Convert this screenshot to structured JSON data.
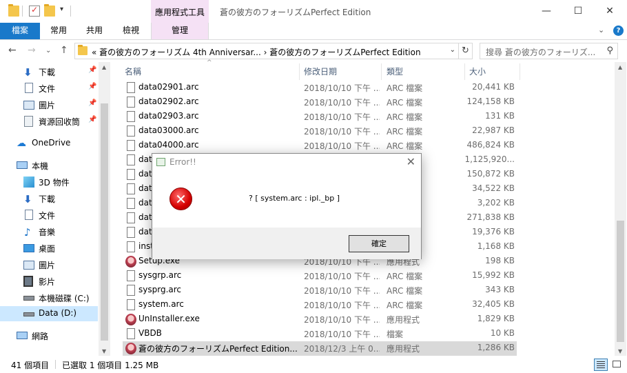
{
  "titlebar": {
    "context_tab_title": "應用程式工具",
    "window_title": "蒼の彼方のフォーリズムPerfect Edition",
    "minimize": "—",
    "maximize": "☐",
    "close": "✕"
  },
  "ribbon": {
    "tabs": [
      "檔案",
      "常用",
      "共用",
      "檢視",
      "管理"
    ]
  },
  "address": {
    "path": "« 蒼の彼方のフォーリズム 4th Anniversar...  ›  蒼の彼方のフォーリズムPerfect Edition",
    "search_placeholder": "搜尋 蒼の彼方のフォーリズ..."
  },
  "navpane": {
    "quick_access": [
      {
        "label": "下載",
        "icon": "download-icon"
      },
      {
        "label": "文件",
        "icon": "document-icon"
      },
      {
        "label": "圖片",
        "icon": "picture-icon"
      },
      {
        "label": "資源回收筒",
        "icon": "recycle-bin-icon"
      }
    ],
    "onedrive": "OneDrive",
    "this_pc": "本機",
    "pc_items": [
      {
        "label": "3D 物件",
        "icon": "3d-objects-icon"
      },
      {
        "label": "下載",
        "icon": "download-icon"
      },
      {
        "label": "文件",
        "icon": "document-icon"
      },
      {
        "label": "音樂",
        "icon": "music-icon"
      },
      {
        "label": "桌面",
        "icon": "desktop-icon"
      },
      {
        "label": "圖片",
        "icon": "picture-icon"
      },
      {
        "label": "影片",
        "icon": "video-icon"
      },
      {
        "label": "本機磁碟 (C:)",
        "icon": "drive-icon"
      },
      {
        "label": "Data (D:)",
        "icon": "drive-icon"
      }
    ],
    "network": "網路"
  },
  "columns": {
    "name": "名稱",
    "date": "修改日期",
    "type": "類型",
    "size": "大小"
  },
  "files": [
    {
      "name": "data02901.arc",
      "date": "2018/10/10 下午 ...",
      "type": "ARC 檔案",
      "size": "20,441 KB",
      "icon": "doc"
    },
    {
      "name": "data02902.arc",
      "date": "2018/10/10 下午 ...",
      "type": "ARC 檔案",
      "size": "124,158 KB",
      "icon": "doc"
    },
    {
      "name": "data02903.arc",
      "date": "2018/10/10 下午 ...",
      "type": "ARC 檔案",
      "size": "131 KB",
      "icon": "doc"
    },
    {
      "name": "data03000.arc",
      "date": "2018/10/10 下午 ...",
      "type": "ARC 檔案",
      "size": "22,987 KB",
      "icon": "doc"
    },
    {
      "name": "data04000.arc",
      "date": "2018/10/10 下午 ...",
      "type": "ARC 檔案",
      "size": "486,824 KB",
      "icon": "doc"
    },
    {
      "name": "dat",
      "date": "",
      "type": "",
      "size": "1,125,920...",
      "icon": "doc"
    },
    {
      "name": "dat",
      "date": "",
      "type": "",
      "size": "150,872 KB",
      "icon": "doc"
    },
    {
      "name": "dat",
      "date": "",
      "type": "",
      "size": "34,522 KB",
      "icon": "doc"
    },
    {
      "name": "dat",
      "date": "",
      "type": "",
      "size": "3,202 KB",
      "icon": "doc"
    },
    {
      "name": "dat",
      "date": "",
      "type": "",
      "size": "271,838 KB",
      "icon": "doc"
    },
    {
      "name": "dat",
      "date": "",
      "type": "",
      "size": "19,376 KB",
      "icon": "doc"
    },
    {
      "name": "inst",
      "date": "",
      "type": "",
      "size": "1,168 KB",
      "icon": "doc"
    },
    {
      "name": "Setup.exe",
      "date": "2018/10/10 下午 ...",
      "type": "應用程式",
      "size": "198 KB",
      "icon": "app"
    },
    {
      "name": "sysgrp.arc",
      "date": "2018/10/10 下午 ...",
      "type": "ARC 檔案",
      "size": "15,992 KB",
      "icon": "doc"
    },
    {
      "name": "sysprg.arc",
      "date": "2018/10/10 下午 ...",
      "type": "ARC 檔案",
      "size": "343 KB",
      "icon": "doc"
    },
    {
      "name": "system.arc",
      "date": "2018/10/10 下午 ...",
      "type": "ARC 檔案",
      "size": "32,405 KB",
      "icon": "doc"
    },
    {
      "name": "UnInstaller.exe",
      "date": "2018/10/10 下午 ...",
      "type": "應用程式",
      "size": "1,829 KB",
      "icon": "app"
    },
    {
      "name": "VBDB",
      "date": "2018/10/10 下午 ...",
      "type": "檔案",
      "size": "10 KB",
      "icon": "doc"
    },
    {
      "name": "蒼の彼方のフォーリズムPerfect Edition....",
      "date": "2018/12/3 上午 0...",
      "type": "應用程式",
      "size": "1,286 KB",
      "icon": "app",
      "selected": true
    }
  ],
  "status": {
    "item_count": "41 個項目",
    "selected": "已選取 1 個項目  1.25 MB"
  },
  "dialog": {
    "title": "Error!!",
    "message": "? [ system.arc : ipl._bp ]",
    "ok_label": "確定"
  }
}
